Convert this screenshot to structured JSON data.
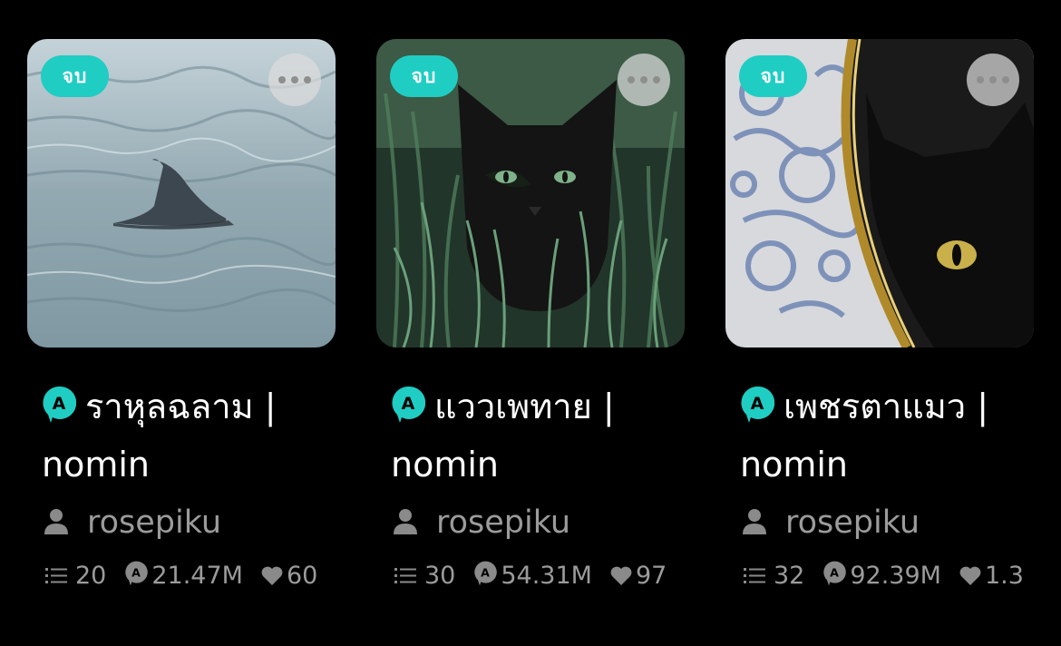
{
  "cards": [
    {
      "badge": "จบ",
      "title_line1": "ราหุลฉลาม |",
      "title_line2": "nomin",
      "author": "rosepiku",
      "chapters": "20",
      "views": "21.47M",
      "likes": "60",
      "image": "shark-fin-in-sea"
    },
    {
      "badge": "จบ",
      "title_line1": "แววเพทาย |",
      "title_line2": "nomin",
      "author": "rosepiku",
      "chapters": "30",
      "views": "54.31M",
      "likes": "97",
      "image": "black-cat-in-grass"
    },
    {
      "badge": "จบ",
      "title_line1": "เพชรตาแมว |",
      "title_line2": "nomin",
      "author": "rosepiku",
      "chapters": "32",
      "views": "92.39M",
      "likes": "1.3",
      "image": "black-cat-in-porcelain-vase"
    }
  ],
  "colors": {
    "badge": "#1fcdc3",
    "background": "#000000",
    "muted_text": "#9b9b9b"
  }
}
